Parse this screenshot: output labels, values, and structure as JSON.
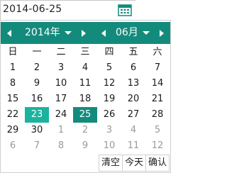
{
  "input": {
    "value": "2014-06-25"
  },
  "header": {
    "year_label": "2014年",
    "month_label": "06月"
  },
  "weekdays": [
    "日",
    "一",
    "二",
    "三",
    "四",
    "五",
    "六"
  ],
  "weeks": [
    [
      {
        "d": "1"
      },
      {
        "d": "2"
      },
      {
        "d": "3"
      },
      {
        "d": "4"
      },
      {
        "d": "5"
      },
      {
        "d": "6"
      },
      {
        "d": "7"
      }
    ],
    [
      {
        "d": "8"
      },
      {
        "d": "9"
      },
      {
        "d": "10"
      },
      {
        "d": "11"
      },
      {
        "d": "12"
      },
      {
        "d": "13"
      },
      {
        "d": "14"
      }
    ],
    [
      {
        "d": "15"
      },
      {
        "d": "16"
      },
      {
        "d": "17"
      },
      {
        "d": "18"
      },
      {
        "d": "19"
      },
      {
        "d": "20"
      },
      {
        "d": "21"
      }
    ],
    [
      {
        "d": "22"
      },
      {
        "d": "23",
        "state": "today"
      },
      {
        "d": "24"
      },
      {
        "d": "25",
        "state": "selected"
      },
      {
        "d": "26"
      },
      {
        "d": "27"
      },
      {
        "d": "28"
      }
    ],
    [
      {
        "d": "29"
      },
      {
        "d": "30"
      },
      {
        "d": "1",
        "state": "other"
      },
      {
        "d": "2",
        "state": "other"
      },
      {
        "d": "3",
        "state": "other"
      },
      {
        "d": "4",
        "state": "other"
      },
      {
        "d": "5",
        "state": "other"
      }
    ],
    [
      {
        "d": "6",
        "state": "other"
      },
      {
        "d": "7",
        "state": "other"
      },
      {
        "d": "8",
        "state": "other"
      },
      {
        "d": "9",
        "state": "other"
      },
      {
        "d": "10",
        "state": "other"
      },
      {
        "d": "11",
        "state": "other"
      },
      {
        "d": "12",
        "state": "other"
      }
    ]
  ],
  "footer": {
    "clear_label": "清空",
    "today_label": "今天",
    "confirm_label": "确认"
  },
  "colors": {
    "header_bg": "#138b7c",
    "selected_bg": "#138b7c",
    "today_bg": "#1bb39e",
    "other_month_text": "#9a9a9a"
  },
  "icons": {
    "calendar": "calendar-icon",
    "prev": "chevron-left-icon",
    "next": "chevron-right-icon",
    "dropdown": "caret-down-icon"
  }
}
